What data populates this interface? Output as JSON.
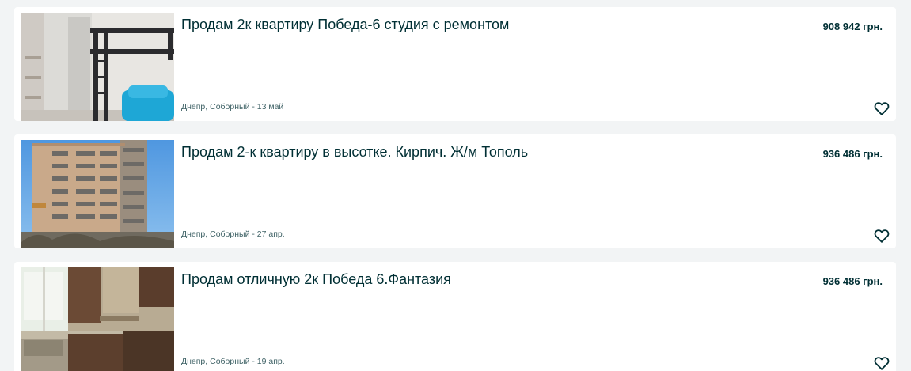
{
  "listings": [
    {
      "title": "Продам 2к квартиру Победа-6 студия с ремонтом",
      "price": "908 942 грн.",
      "location": "Днепр, Соборный",
      "date": "13 май",
      "photo_subject": "apartment interior with loft bed and blue armchair",
      "favorite_icon": "heart-outline-icon"
    },
    {
      "title": "Продам 2-к квартиру в высотке. Кирпич. Ж/м Тополь",
      "price": "936 486 грн.",
      "location": "Днепр, Соборный",
      "date": "27 апр.",
      "photo_subject": "high-rise brick apartment building",
      "favorite_icon": "heart-outline-icon"
    },
    {
      "title": "Продам отличную 2к Победа 6.Фантазия",
      "price": "936 486 грн.",
      "location": "Днепр, Соборный",
      "date": "19 апр.",
      "photo_subject": "kitchen with brown cabinets and window",
      "favorite_icon": "heart-outline-icon"
    }
  ],
  "meta_separator": " - ",
  "colors": {
    "page_background": "#f2f4f5",
    "card_background": "#ffffff",
    "title_text": "#002f34",
    "meta_text": "#406367"
  }
}
